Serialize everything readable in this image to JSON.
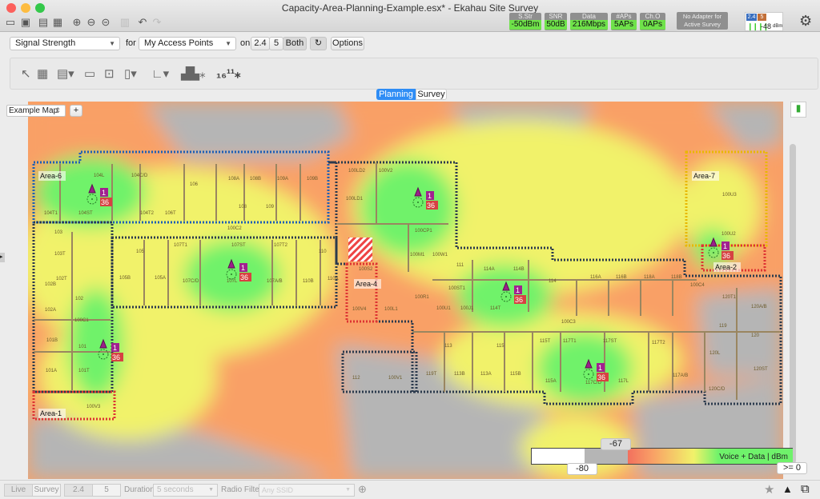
{
  "window": {
    "title": "Capacity-Area-Planning-Example.esx* - Ekahau Site Survey"
  },
  "status": [
    {
      "label": "S.Str",
      "value": "-50dBm"
    },
    {
      "label": "SNR",
      "value": "50dB"
    },
    {
      "label": "Data",
      "value": "216Mbps"
    },
    {
      "label": "#APs",
      "value": "5APs"
    },
    {
      "label": "Ch.O",
      "value": "0APs"
    }
  ],
  "adapter": {
    "text": "No Adapter for Active Survey",
    "band24": "2.4",
    "band5": "5",
    "signal": "-48",
    "unit": "dBm"
  },
  "controls": {
    "visualization": "Signal Strength",
    "for_label": "for",
    "source": "My Access Points",
    "on_label": "on",
    "bands": [
      "2.4",
      "5",
      "Both"
    ],
    "band_selected": "Both",
    "options": "Options"
  },
  "mode_tabs": [
    "Planning",
    "Survey"
  ],
  "mode_selected": "Planning",
  "map": {
    "name": "Example Map",
    "add": "+",
    "areas": [
      "Area-6",
      "Area-1",
      "Area-4",
      "Area-7",
      "Area-2"
    ],
    "rooms": [
      "104L",
      "104C/D",
      "106",
      "108A",
      "108B",
      "109A",
      "109B",
      "104T1",
      "104ST",
      "104T2",
      "106T",
      "108",
      "109",
      "100C2",
      "103",
      "105",
      "107T1",
      "107ST",
      "107T2",
      "110",
      "103T",
      "102B",
      "102T",
      "102",
      "105B",
      "105A",
      "107C/D",
      "107L",
      "107A/B",
      "110B",
      "110A",
      "100LD2",
      "100V2",
      "100LD1",
      "100CP1",
      "100M1",
      "100W1",
      "111",
      "114A",
      "114B",
      "100S2",
      "100R1",
      "100ST1",
      "114",
      "116A",
      "116B",
      "118A",
      "118B",
      "100V4",
      "100L1",
      "100U1",
      "100J1",
      "114T",
      "100U3",
      "100U2",
      "100C4",
      "120T1",
      "120A/B",
      "102A",
      "100C1",
      "101B",
      "101",
      "101A",
      "101T",
      "100V3",
      "112",
      "100V1",
      "100C3",
      "113",
      "115",
      "115T",
      "117T1",
      "117ST",
      "117T2",
      "119T",
      "113B",
      "113A",
      "115B",
      "115A",
      "117C/D",
      "117L",
      "117A/B",
      "119",
      "120",
      "120L",
      "120ST",
      "120C/D",
      "120T2"
    ],
    "ap_channels": {
      "band": "1",
      "channel": "36"
    }
  },
  "colors": {
    "green": "#6ff26b",
    "yellow": "#f1f26a",
    "orange": "#f9a066",
    "red": "#f2705e",
    "gray": "#b5b5b5",
    "accent": "#2f8df5"
  },
  "legend": {
    "top_value": "-67",
    "bottom_value": "-80",
    "max_value": ">= 0",
    "caption": "Voice + Data | dBm"
  },
  "bottom": {
    "live": "Live",
    "survey": "Survey",
    "b24": "2.4",
    "b5": "5",
    "duration_label": "Duration",
    "duration": "5 seconds",
    "radio_filter_label": "Radio Filter",
    "radio_filter": "Any SSID"
  }
}
